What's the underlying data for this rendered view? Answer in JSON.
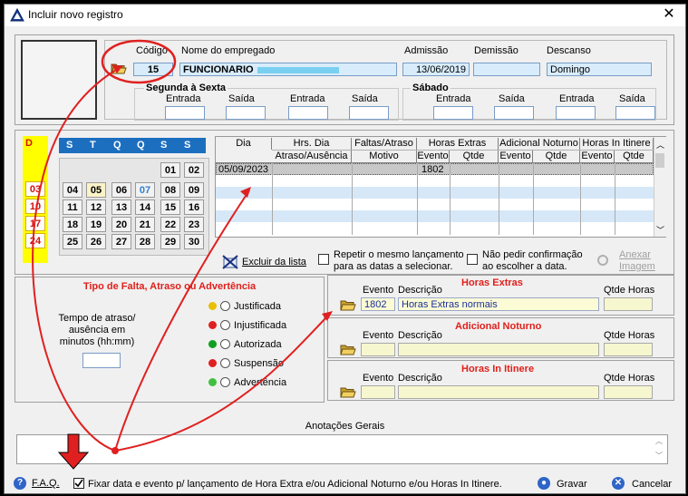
{
  "window": {
    "title": "Incluir novo registro",
    "close_glyph": "✕"
  },
  "employee": {
    "codigo_label": "Código",
    "codigo_value": "15",
    "nome_label": "Nome do empregado",
    "nome_value": "FUNCIONARIO",
    "admissao_label": "Admissão",
    "admissao_value": "13/06/2019",
    "demissao_label": "Demissão",
    "demissao_value": "",
    "descanso_label": "Descanso",
    "descanso_value": "Domingo"
  },
  "schedule": {
    "segunda_label": "Segunda à Sexta",
    "sabado_label": "Sábado",
    "entrada": "Entrada",
    "saida": "Saída"
  },
  "calendar": {
    "day_letter": "D",
    "weekdays": [
      "S",
      "T",
      "Q",
      "Q",
      "S",
      "S"
    ],
    "sundays": [
      "03",
      "10",
      "17",
      "24"
    ],
    "rows": [
      [
        "",
        "",
        "",
        "",
        "01",
        "02"
      ],
      [
        "04",
        "05",
        "06",
        "07",
        "08",
        "09"
      ],
      [
        "11",
        "12",
        "13",
        "14",
        "15",
        "16"
      ],
      [
        "18",
        "19",
        "20",
        "21",
        "22",
        "23"
      ],
      [
        "25",
        "26",
        "27",
        "28",
        "29",
        "30"
      ]
    ],
    "highlight_day": "05",
    "blue_day": "07"
  },
  "grid": {
    "headers_top": [
      "Dia",
      "Hrs. Dia",
      "Faltas/Atraso",
      "Horas Extras",
      "Adicional Noturno",
      "Horas In Itinere"
    ],
    "headers_sub": [
      "Atraso/Ausência",
      "Motivo",
      "Evento",
      "Qtde",
      "Evento",
      "Qtde",
      "Evento",
      "Qtde"
    ],
    "row_dia": "05/09/2023",
    "row_evento": "1802"
  },
  "actions": {
    "excluir": "Excluir da lista",
    "repetir_1": "Repetir o mesmo lançamento",
    "repetir_2": "para as datas a selecionar.",
    "naopedir_1": "Não pedir confirmação",
    "naopedir_2": "ao escolher a data.",
    "anexar_1": "Anexar",
    "anexar_2": "Imagem"
  },
  "falta": {
    "title": "Tipo de Falta, Atraso ou Advertência",
    "tempo_1": "Tempo de atraso/",
    "tempo_2": "ausência em",
    "tempo_3": "minutos (hh:mm)",
    "opcoes": [
      "Justificada",
      "Injustificada",
      "Autorizada",
      "Suspensão",
      "Advertência"
    ]
  },
  "extras": {
    "he_title": "Horas Extras",
    "he_evento": "1802",
    "he_desc": "Horas Extras normais",
    "an_title": "Adicional Noturno",
    "hi_title": "Horas In Itinere",
    "evento": "Evento",
    "descricao": "Descrição",
    "qtde": "Qtde Horas"
  },
  "notes": {
    "label": "Anotações Gerais"
  },
  "footer": {
    "faq": "F.A.Q.",
    "fixar": "Fixar data e evento p/ lançamento de Hora Extra e/ou Adicional Noturno e/ou Horas In Itinere.",
    "gravar": "Gravar",
    "cancelar": "Cancelar"
  }
}
